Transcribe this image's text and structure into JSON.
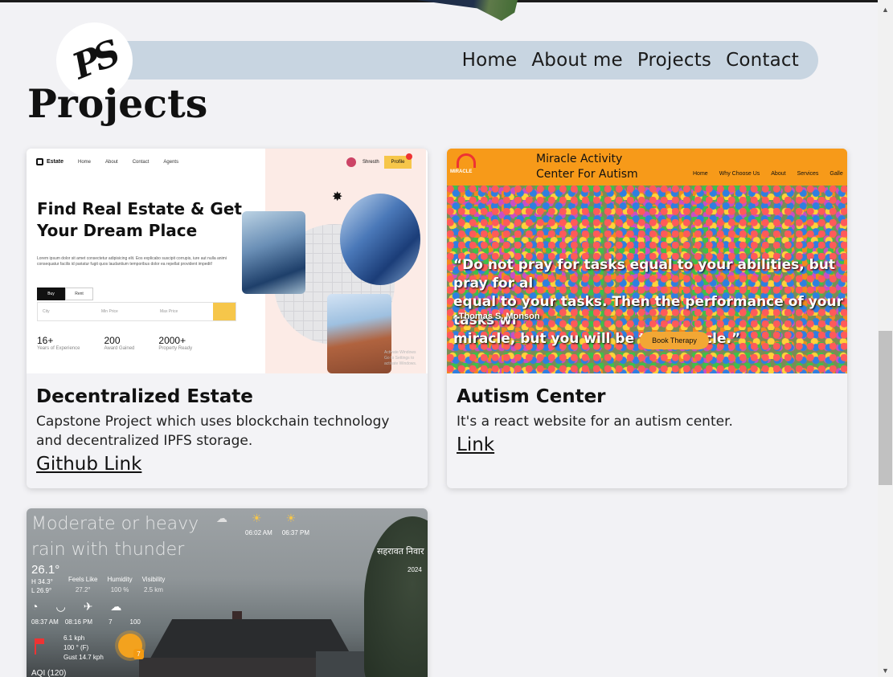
{
  "nav": {
    "logo_text": "PS",
    "links": [
      "Home",
      "About me",
      "Projects",
      "Contact"
    ]
  },
  "section_title": "Projects",
  "projects": [
    {
      "title": "Decentralized Estate",
      "description": "Capstone Project which uses blockchain technology and decentralized IPFS storage.",
      "link_label": "Github Link",
      "preview": {
        "brand": "Estate",
        "menu": [
          "Home",
          "About",
          "Contact",
          "Agents"
        ],
        "user": "Shresth",
        "profile_btn": "Profile",
        "heading": "Find Real Estate & Get Your Dream Place",
        "paragraph": "Lorem ipsum dolor sit amet consectetur adipisicing elit. Eos explicabo suscipit corrupis, iure aut nulla animi consequatur facilis id pariatur fugit quos laudantium temporibus dolor ea repellat provident impedit!",
        "tabs": [
          "Buy",
          "Rent"
        ],
        "search_fields": [
          "City",
          "Min Price",
          "Max Price"
        ],
        "stats": [
          {
            "value": "16+",
            "label": "Years of Experience"
          },
          {
            "value": "200",
            "label": "Award Gained"
          },
          {
            "value": "2000+",
            "label": "Property Ready"
          }
        ],
        "watermark": "Activate Windows\nGo to Settings to activate Windows."
      }
    },
    {
      "title": "Autism Center",
      "description": "It's a react website for an autism center.",
      "link_label": "Link",
      "preview": {
        "logo_text": "MIRACLE",
        "title": "Miracle Activity\nCenter For Autism",
        "menu": [
          "Home",
          "Why Choose Us",
          "About",
          "Services",
          "Galle"
        ],
        "quote": "“Do not pray for tasks equal to your abilities, but pray for al\nequal to your tasks. Then the performance of your tasks wi\nmiracle, but you will be the miracle.”",
        "author": "- Thomas S. Monson",
        "button": "Book Therapy"
      }
    },
    {
      "preview": {
        "condition": "Moderate or heavy rain with thunder",
        "temp": "26.1°",
        "high": "H 34.3°",
        "low": "L 26.9°",
        "metrics": [
          {
            "label": "Feels Like",
            "value": "27.2°"
          },
          {
            "label": "Humidity",
            "value": "100 %"
          },
          {
            "label": "Visibility",
            "value": "2.5 km"
          }
        ],
        "times": [
          "08:37 AM",
          "08:16 PM",
          "7",
          "100"
        ],
        "sun_times": [
          "06:02 AM",
          "06:37 PM"
        ],
        "location": "सहरावत निवार",
        "year": "2024",
        "wind": "6.1 kph\n100 ° (F)\nGust 14.7 kph",
        "uv": "7",
        "aqi": "AQI (120)"
      }
    }
  ]
}
